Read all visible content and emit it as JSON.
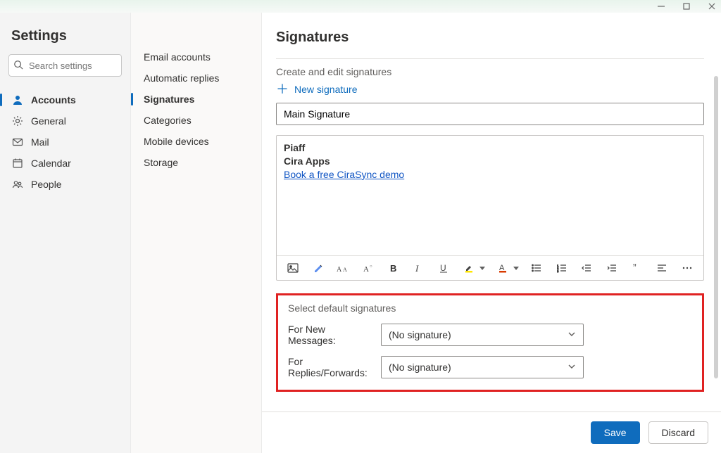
{
  "title": "Settings",
  "search": {
    "placeholder": "Search settings"
  },
  "categories": [
    {
      "icon": "person",
      "label": "Accounts",
      "active": true
    },
    {
      "icon": "gear",
      "label": "General"
    },
    {
      "icon": "mail",
      "label": "Mail"
    },
    {
      "icon": "calendar",
      "label": "Calendar"
    },
    {
      "icon": "people",
      "label": "People"
    }
  ],
  "subnav": [
    {
      "label": "Email accounts"
    },
    {
      "label": "Automatic replies"
    },
    {
      "label": "Signatures",
      "active": true
    },
    {
      "label": "Categories"
    },
    {
      "label": "Mobile devices"
    },
    {
      "label": "Storage"
    }
  ],
  "main": {
    "header": "Signatures",
    "create_heading": "Create and edit signatures",
    "new_signature_label": "New signature",
    "signature_name": "Main Signature",
    "editor_lines": {
      "line1": "Piaff",
      "line2": "Cira Apps",
      "link_text": "Book a free CiraSync demo"
    },
    "defaults": {
      "heading": "Select default signatures",
      "new_label": "For New Messages:",
      "new_value": "(No signature)",
      "replies_label": "For Replies/Forwards:",
      "replies_value": "(No signature)"
    }
  },
  "footer": {
    "save": "Save",
    "discard": "Discard"
  },
  "colors": {
    "accent": "#0F6CBD",
    "highlight_border": "#e02222"
  }
}
